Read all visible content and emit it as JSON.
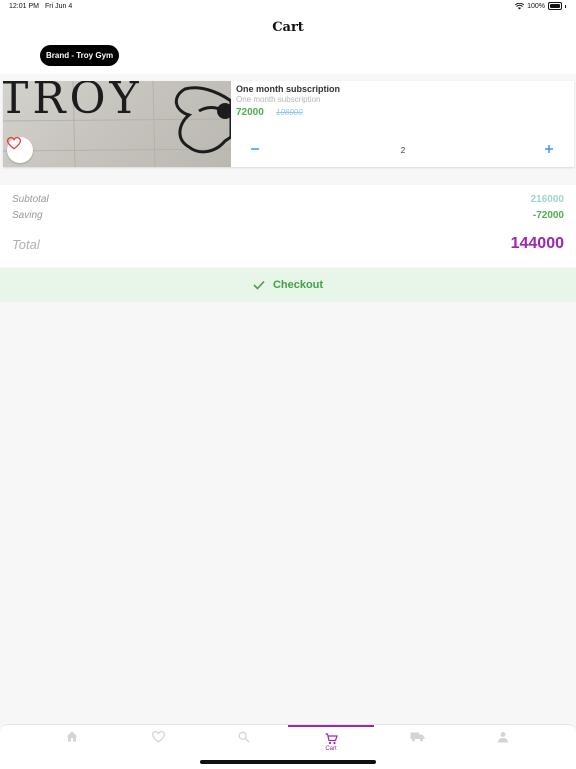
{
  "status_bar": {
    "time": "12:01 PM",
    "date": "Fri Jun 4",
    "battery_text": "100%",
    "icons": [
      "wifi-icon",
      "battery-icon"
    ]
  },
  "header": {
    "title": "Cart",
    "brand_chip": "Brand - Troy Gym"
  },
  "cart_items": [
    {
      "title": "One month subscription",
      "subtitle": "One month subscription",
      "price": "72000",
      "old_price": "108000",
      "quantity": "2",
      "image_text": "TROY",
      "favorite_icon": "heart-outline-icon",
      "minus_icon": "minus-icon",
      "plus_icon": "plus-icon"
    }
  ],
  "summary": {
    "subtotal_label": "Subtotal",
    "subtotal_value": "216000",
    "saving_label": "Saving",
    "saving_value": "-72000",
    "total_label": "Total",
    "total_value": "144000"
  },
  "checkout": {
    "label": "Checkout",
    "icon": "check-icon"
  },
  "bottom_nav": {
    "items": [
      {
        "icon": "home-icon",
        "label": ""
      },
      {
        "icon": "heart-icon",
        "label": ""
      },
      {
        "icon": "search-icon",
        "label": ""
      },
      {
        "icon": "cart-icon",
        "label": "Cart",
        "active": true
      },
      {
        "icon": "truck-icon",
        "label": ""
      },
      {
        "icon": "person-icon",
        "label": ""
      }
    ]
  },
  "colors": {
    "accent": "#9c27b0",
    "price_green": "#4caf50",
    "old_price_blue": "#8fc9ec",
    "subtotal_teal": "#9ed6cf",
    "checkout_bg": "#e8f5e9",
    "favorite_red": "#e53935"
  }
}
